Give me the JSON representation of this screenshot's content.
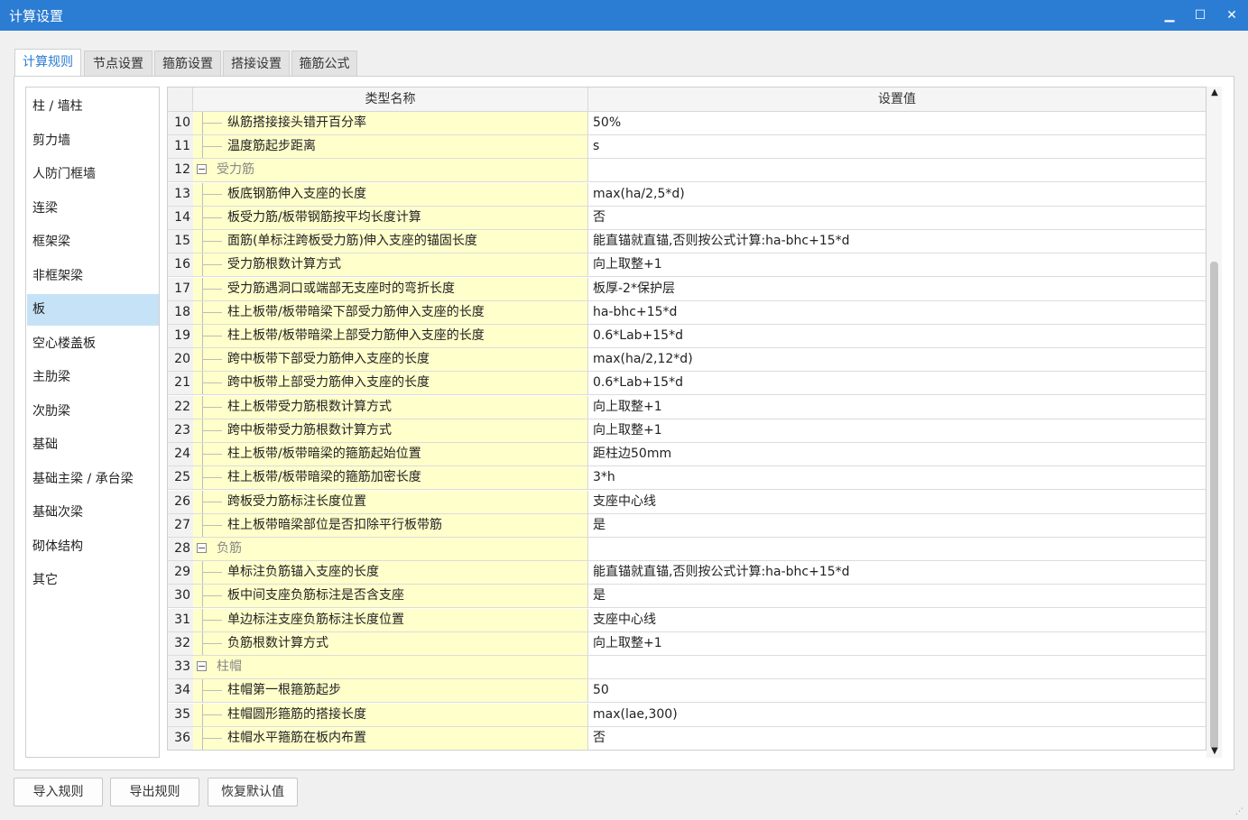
{
  "window": {
    "title": "计算设置",
    "minimize_glyph": "▁",
    "maximize_glyph": "☐",
    "close_glyph": "✕"
  },
  "tabs": [
    "计算规则",
    "节点设置",
    "箍筋设置",
    "搭接设置",
    "箍筋公式"
  ],
  "active_tab": 0,
  "sidebar": {
    "items": [
      "柱 / 墙柱",
      "剪力墙",
      "人防门框墙",
      "连梁",
      "框架梁",
      "非框架梁",
      "板",
      "空心楼盖板",
      "主肋梁",
      "次肋梁",
      "基础",
      "基础主梁 / 承台梁",
      "基础次梁",
      "砌体结构",
      "其它"
    ],
    "selected": 6
  },
  "grid": {
    "columns": [
      "类型名称",
      "设置值"
    ],
    "rows": [
      {
        "num": "10",
        "name": "纵筋搭接接头错开百分率",
        "value": "50%",
        "group": false
      },
      {
        "num": "11",
        "name": "温度筋起步距离",
        "value": "s",
        "group": false
      },
      {
        "num": "12",
        "name": "受力筋",
        "value": "",
        "group": true
      },
      {
        "num": "13",
        "name": "板底钢筋伸入支座的长度",
        "value": "max(ha/2,5*d)",
        "group": false
      },
      {
        "num": "14",
        "name": "板受力筋/板带钢筋按平均长度计算",
        "value": "否",
        "group": false
      },
      {
        "num": "15",
        "name": "面筋(单标注跨板受力筋)伸入支座的锚固长度",
        "value": "能直锚就直锚,否则按公式计算:ha-bhc+15*d",
        "group": false
      },
      {
        "num": "16",
        "name": "受力筋根数计算方式",
        "value": "向上取整+1",
        "group": false
      },
      {
        "num": "17",
        "name": "受力筋遇洞口或端部无支座时的弯折长度",
        "value": "板厚-2*保护层",
        "group": false
      },
      {
        "num": "18",
        "name": "柱上板带/板带暗梁下部受力筋伸入支座的长度",
        "value": "ha-bhc+15*d",
        "group": false
      },
      {
        "num": "19",
        "name": "柱上板带/板带暗梁上部受力筋伸入支座的长度",
        "value": "0.6*Lab+15*d",
        "group": false
      },
      {
        "num": "20",
        "name": "跨中板带下部受力筋伸入支座的长度",
        "value": "max(ha/2,12*d)",
        "group": false
      },
      {
        "num": "21",
        "name": "跨中板带上部受力筋伸入支座的长度",
        "value": "0.6*Lab+15*d",
        "group": false
      },
      {
        "num": "22",
        "name": "柱上板带受力筋根数计算方式",
        "value": "向上取整+1",
        "group": false
      },
      {
        "num": "23",
        "name": "跨中板带受力筋根数计算方式",
        "value": "向上取整+1",
        "group": false
      },
      {
        "num": "24",
        "name": "柱上板带/板带暗梁的箍筋起始位置",
        "value": "距柱边50mm",
        "group": false
      },
      {
        "num": "25",
        "name": "柱上板带/板带暗梁的箍筋加密长度",
        "value": "3*h",
        "group": false
      },
      {
        "num": "26",
        "name": "跨板受力筋标注长度位置",
        "value": "支座中心线",
        "group": false
      },
      {
        "num": "27",
        "name": "柱上板带暗梁部位是否扣除平行板带筋",
        "value": "是",
        "group": false
      },
      {
        "num": "28",
        "name": "负筋",
        "value": "",
        "group": true
      },
      {
        "num": "29",
        "name": "单标注负筋锚入支座的长度",
        "value": "能直锚就直锚,否则按公式计算:ha-bhc+15*d",
        "group": false
      },
      {
        "num": "30",
        "name": "板中间支座负筋标注是否含支座",
        "value": "是",
        "group": false
      },
      {
        "num": "31",
        "name": "单边标注支座负筋标注长度位置",
        "value": "支座中心线",
        "group": false
      },
      {
        "num": "32",
        "name": "负筋根数计算方式",
        "value": "向上取整+1",
        "group": false
      },
      {
        "num": "33",
        "name": "柱帽",
        "value": "",
        "group": true
      },
      {
        "num": "34",
        "name": "柱帽第一根箍筋起步",
        "value": "50",
        "group": false
      },
      {
        "num": "35",
        "name": "柱帽圆形箍筋的搭接长度",
        "value": "max(lae,300)",
        "group": false
      },
      {
        "num": "36",
        "name": "柱帽水平箍筋在板内布置",
        "value": "否",
        "group": false
      }
    ]
  },
  "buttons": {
    "import": "导入规则",
    "export": "导出规则",
    "restore": "恢复默认值"
  },
  "colors": {
    "titlebar": "#2b7cd3",
    "name_cell_bg": "#ffffcc",
    "selected_bg": "#c6e2f7"
  }
}
